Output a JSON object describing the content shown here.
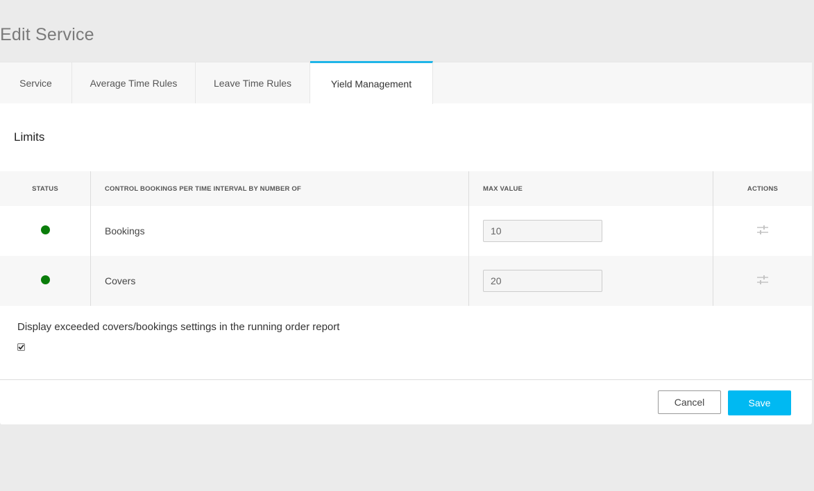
{
  "page": {
    "title": "Edit Service"
  },
  "tabs": [
    {
      "label": "Service",
      "active": false
    },
    {
      "label": "Average Time Rules",
      "active": false
    },
    {
      "label": "Leave Time Rules",
      "active": false
    },
    {
      "label": "Yield Management",
      "active": true
    }
  ],
  "limits": {
    "title": "Limits",
    "columns": {
      "status": "STATUS",
      "control": "CONTROL BOOKINGS PER TIME INTERVAL BY NUMBER OF",
      "max_value": "MAX VALUE",
      "actions": "ACTIONS"
    },
    "rows": [
      {
        "status": "active",
        "status_color": "#0a7d0a",
        "name": "Bookings",
        "max_value": "10",
        "action_icon": "sliders-icon"
      },
      {
        "status": "active",
        "status_color": "#0a7d0a",
        "name": "Covers",
        "max_value": "20",
        "action_icon": "sliders-icon"
      }
    ]
  },
  "report_option": {
    "label": "Display exceeded covers/bookings settings in the running order report",
    "checked": true
  },
  "footer": {
    "cancel_label": "Cancel",
    "save_label": "Save"
  },
  "colors": {
    "accent": "#1fb5e8",
    "save_button": "#00b9f2",
    "status_active": "#0a7d0a"
  }
}
